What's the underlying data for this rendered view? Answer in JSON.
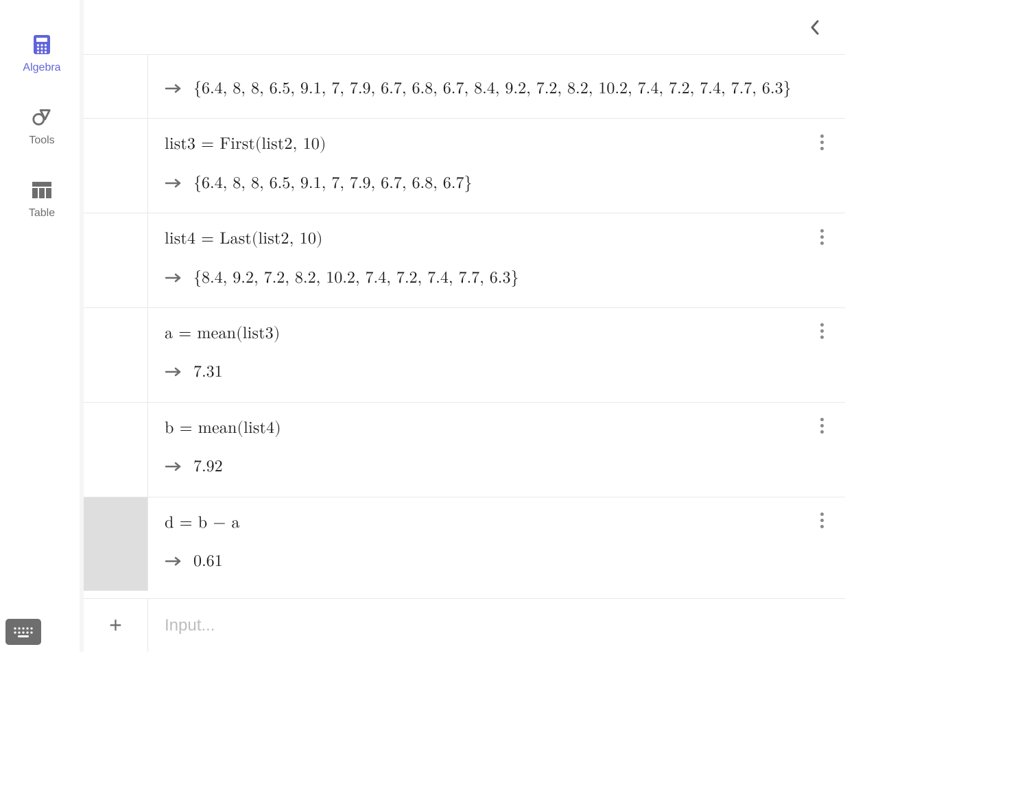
{
  "sidebar": {
    "items": [
      {
        "label": "Algebra",
        "name": "nav-algebra",
        "active": true
      },
      {
        "label": "Tools",
        "name": "nav-tools",
        "active": false
      },
      {
        "label": "Table",
        "name": "nav-table",
        "active": false
      }
    ]
  },
  "input_placeholder": "Input...",
  "rows": [
    {
      "id": "r0",
      "partial": true,
      "selected": false,
      "expression": "",
      "result": "{6.4, 8, 8, 6.5, 9.1, 7, 7.9, 6.7, 6.8, 6.7, 8.4, 9.2, 7.2, 8.2, 10.2, 7.4, 7.2, 7.4, 7.7, 6.3}"
    },
    {
      "id": "r1",
      "selected": false,
      "expression": "list3  =  First(list2, 10)",
      "result": "{6.4, 8, 8, 6.5, 9.1, 7, 7.9, 6.7, 6.8, 6.7}"
    },
    {
      "id": "r2",
      "selected": false,
      "expression": "list4  =  Last(list2, 10)",
      "result": "{8.4, 9.2, 7.2, 8.2, 10.2, 7.4, 7.2, 7.4, 7.7, 6.3}"
    },
    {
      "id": "r3",
      "selected": false,
      "expression": "a  =  mean(list3)",
      "result": "7.31"
    },
    {
      "id": "r4",
      "selected": false,
      "expression": "b  =  mean(list4)",
      "result": "7.92"
    },
    {
      "id": "r5",
      "selected": true,
      "expression": "d  =  b − a",
      "result": "0.61"
    }
  ]
}
